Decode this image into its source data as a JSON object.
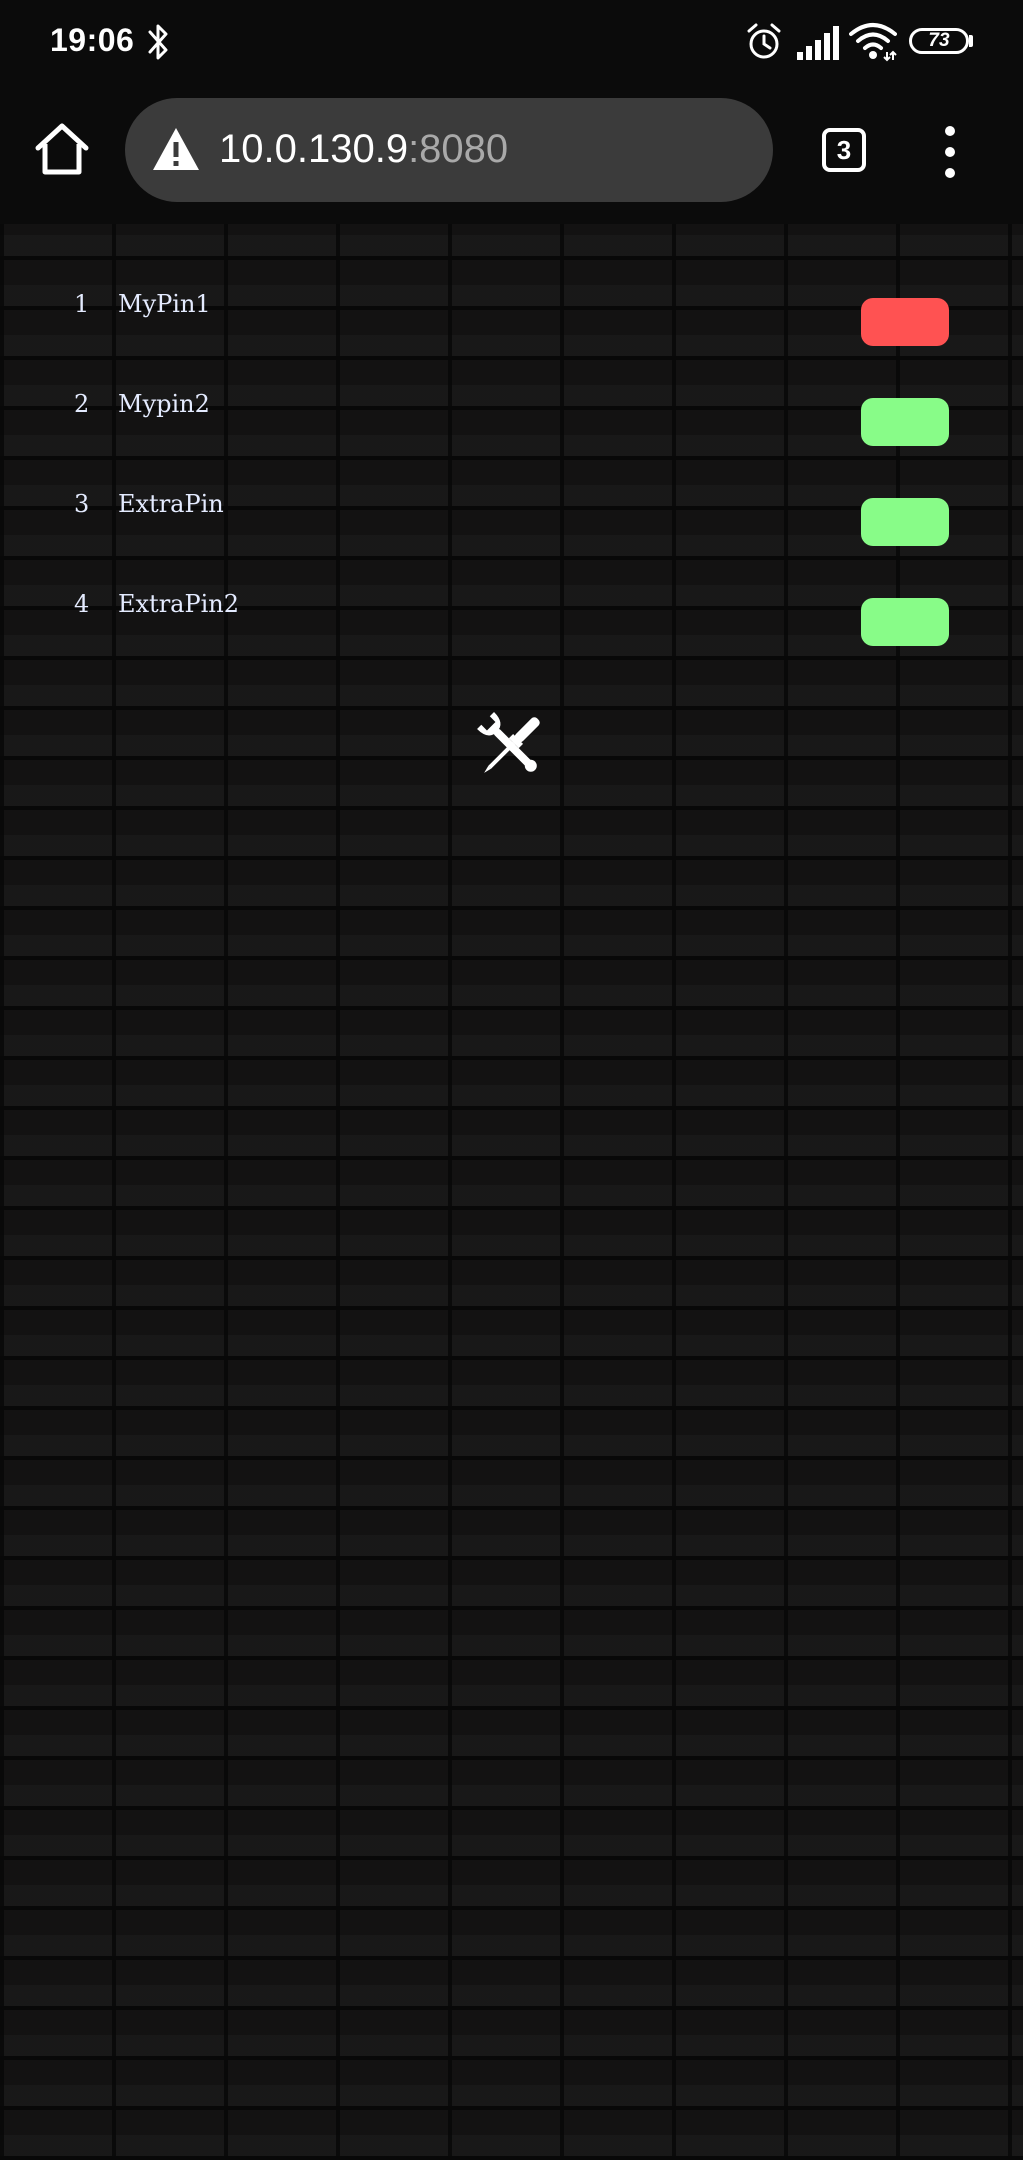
{
  "status_bar": {
    "time": "19:06",
    "battery": "73",
    "icons": [
      "bluetooth-icon",
      "alarm-icon",
      "signal-icon",
      "wifi-icon",
      "battery-icon"
    ]
  },
  "browser": {
    "url_host": "10.0.130.9",
    "url_port": ":8080",
    "tab_count": "3",
    "icons": [
      "home-icon",
      "warning-icon",
      "tabs-icon",
      "more-vert-icon"
    ]
  },
  "pins": [
    {
      "number": "1",
      "name": "MyPin1",
      "state_color": "#ff5252"
    },
    {
      "number": "2",
      "name": "Mypin2",
      "state_color": "#88fc88"
    },
    {
      "number": "3",
      "name": "ExtraPin",
      "state_color": "#88fc88"
    },
    {
      "number": "4",
      "name": "ExtraPin2",
      "state_color": "#88fc88"
    }
  ],
  "settings": {
    "icon": "tools-icon"
  },
  "colors": {
    "off": "#ff5252",
    "on": "#88fc88",
    "text": "#e4ebff",
    "background": "#141313"
  }
}
